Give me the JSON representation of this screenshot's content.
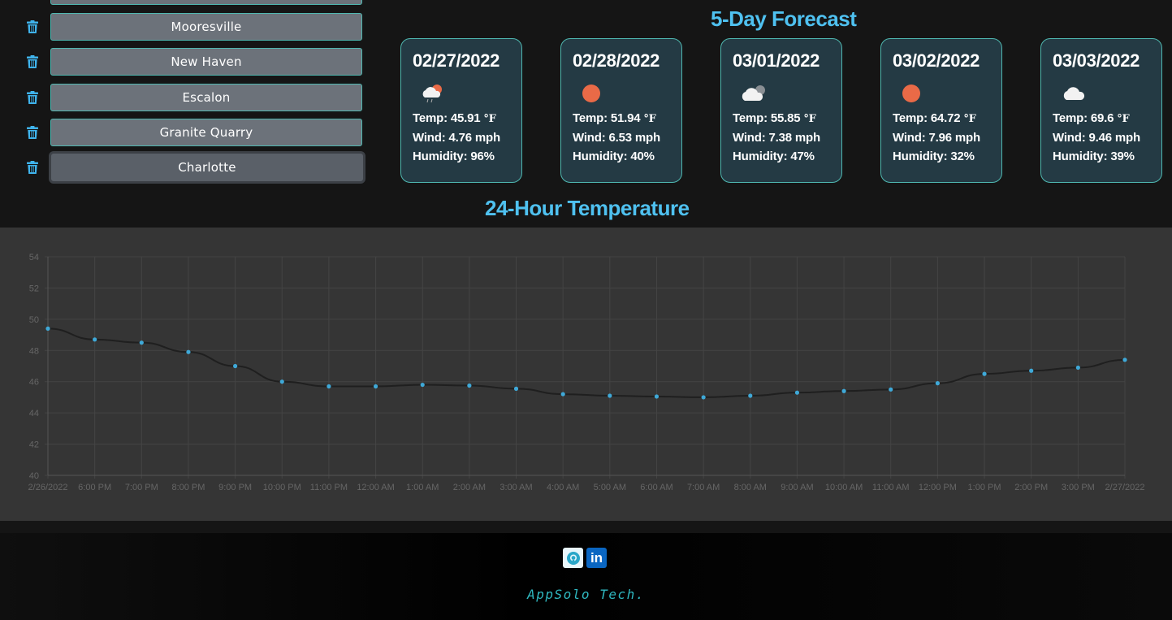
{
  "sidebar": {
    "cities": [
      {
        "label": "Mooresville",
        "active": false
      },
      {
        "label": "New Haven",
        "active": false
      },
      {
        "label": "Escalon",
        "active": false
      },
      {
        "label": "Granite Quarry",
        "active": false
      },
      {
        "label": "Charlotte",
        "active": true
      }
    ]
  },
  "forecast": {
    "title": "5-Day Forecast",
    "days": [
      {
        "date": "02/27/2022",
        "icon": "rain-cloud-sun-icon",
        "temp": "Temp: 45.91 ",
        "wind": "Wind: 4.76 mph",
        "humidity": "Humidity: 96%"
      },
      {
        "date": "02/28/2022",
        "icon": "sun-icon",
        "temp": "Temp: 51.94 ",
        "wind": "Wind: 6.53 mph",
        "humidity": "Humidity: 40%"
      },
      {
        "date": "03/01/2022",
        "icon": "cloudy-icon",
        "temp": "Temp: 55.85 ",
        "wind": "Wind: 7.38 mph",
        "humidity": "Humidity: 47%"
      },
      {
        "date": "03/02/2022",
        "icon": "sun-icon",
        "temp": "Temp: 64.72 ",
        "wind": "Wind: 7.96 mph",
        "humidity": "Humidity: 32%"
      },
      {
        "date": "03/03/2022",
        "icon": "cloud-icon",
        "temp": "Temp: 69.6 ",
        "wind": "Wind: 9.46 mph",
        "humidity": "Humidity: 39%"
      }
    ],
    "temp_unit": "°F"
  },
  "chart_title": "24-Hour Temperature",
  "chart_data": {
    "type": "line",
    "title": "24-Hour Temperature",
    "xlabel": "",
    "ylabel": "",
    "categories": [
      "2/26/2022",
      "6:00 PM",
      "7:00 PM",
      "8:00 PM",
      "9:00 PM",
      "10:00 PM",
      "11:00 PM",
      "12:00 AM",
      "1:00 AM",
      "2:00 AM",
      "3:00 AM",
      "4:00 AM",
      "5:00 AM",
      "6:00 AM",
      "7:00 AM",
      "8:00 AM",
      "9:00 AM",
      "10:00 AM",
      "11:00 AM",
      "12:00 PM",
      "1:00 PM",
      "2:00 PM",
      "3:00 PM",
      "2/27/2022"
    ],
    "values": [
      49.4,
      48.7,
      48.5,
      47.9,
      47.0,
      46.0,
      45.7,
      45.7,
      45.8,
      45.75,
      45.55,
      45.2,
      45.1,
      45.05,
      45.0,
      45.1,
      45.3,
      45.4,
      45.5,
      45.9,
      46.5,
      46.7,
      46.9,
      47.4
    ],
    "ylim": [
      40,
      54
    ],
    "yticks": [
      40,
      42,
      44,
      46,
      48,
      50,
      52,
      54
    ],
    "grid": true,
    "line_color": "#1f1f1f",
    "point_color": "#3fa9d8"
  },
  "footer": {
    "brand": "AppSolo Tech.",
    "github_icon": "github-icon",
    "linkedin_icon": "linkedin-icon",
    "linkedin_text": "in"
  },
  "colors": {
    "accent": "#4fc1f0",
    "card_bg": "#243a44",
    "card_border": "#4fb7b0",
    "button_bg": "#6c727a"
  }
}
